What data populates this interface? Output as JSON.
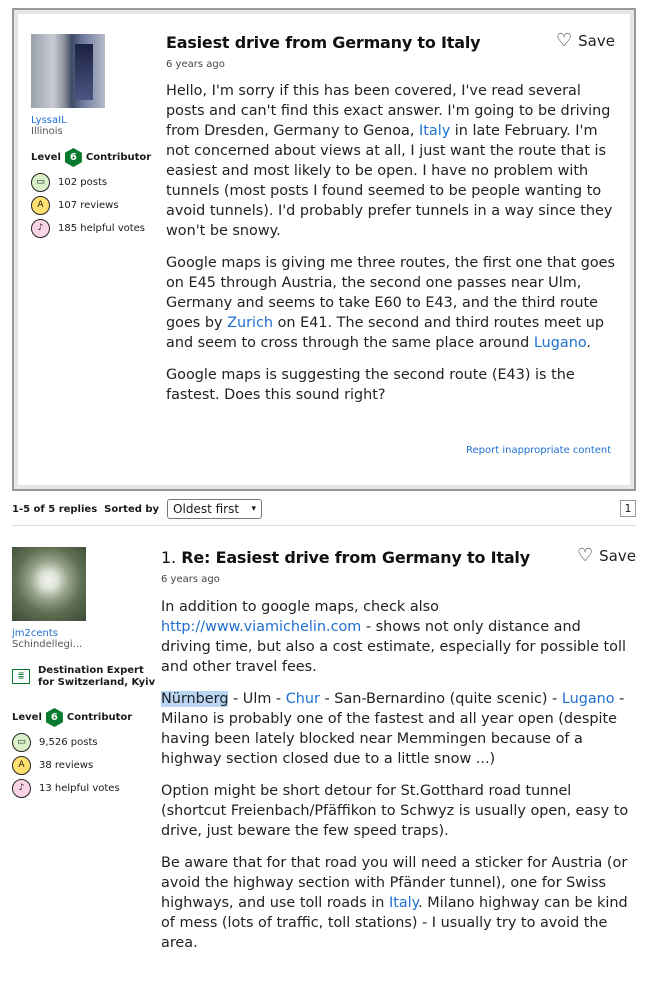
{
  "question": {
    "author": {
      "name": "LyssaIL",
      "location": "Illinois",
      "level_label": "Level",
      "level": "6",
      "level_suffix": "Contributor"
    },
    "stats": {
      "posts": "102 posts",
      "reviews": "107 reviews",
      "votes": "185 helpful votes"
    },
    "title": "Easiest drive from Germany to Italy",
    "time": "6 years ago",
    "save_label": "Save",
    "p1_a": "Hello, I'm sorry if this has been covered, I've read several posts and can't find this exact answer. I'm going to be driving from Dresden, Germany to Genoa, ",
    "p1_link": "Italy",
    "p1_b": " in late February. I'm not concerned about views at all, I just want the route that is easiest and most likely to be open. I have no problem with tunnels (most posts I found seemed to be people wanting to avoid tunnels). I'd probably prefer tunnels in a way since they won't be snowy.",
    "p2_a": "Google maps is giving me three routes, the first one that goes on E45 through Austria, the second one passes near Ulm, Germany and seems to take E60 to E43, and the third route goes by ",
    "p2_link1": "Zurich",
    "p2_b": " on E41. The second and third routes meet up and seem to cross through the same place around ",
    "p2_link2": "Lugano",
    "p2_c": ".",
    "p3": "Google maps is suggesting the second route (E43) is the fastest. Does this sound right?",
    "report": "Report inappropriate content"
  },
  "pager": {
    "count": "1-5 of 5 replies",
    "sorted_by": "Sorted by",
    "sort_value": "Oldest first",
    "page": "1"
  },
  "reply": {
    "author": {
      "name": "jm2cents",
      "location": "Schindellegi...",
      "level_label": "Level",
      "level": "6",
      "level_suffix": "Contributor"
    },
    "expert_line1": "Destination Expert",
    "expert_line2": "for Switzerland, Kyiv",
    "stats": {
      "posts": "9,526 posts",
      "reviews": "38 reviews",
      "votes": "13 helpful votes"
    },
    "number": "1.",
    "title": "Re: Easiest drive from Germany to Italy",
    "time": "6 years ago",
    "save_label": "Save",
    "p1_a": "In addition to google maps, check also",
    "p1_link": "http://www.viamichelin.com",
    "p1_b": " - shows not only distance and driving time, but also a cost estimate, especially for possible toll and other travel fees.",
    "p2_hl": "Nürnberg",
    "p2_a": " - Ulm - ",
    "p2_link1": "Chur",
    "p2_b": " - San-Bernardino (quite scenic) - ",
    "p2_link2": "Lugano",
    "p2_c": " - Milano is probably one of the fastest and all year open (despite having been lately blocked near Memmingen because of a highway section closed due to a little snow ...)",
    "p3": "Option might be short detour for St.Gotthard road tunnel (shortcut Freienbach/Pfäffikon to Schwyz is usually open, easy to drive, just beware the few speed traps).",
    "p4_a": "Be aware that for that road you will need a sticker for Austria (or avoid the highway section with Pfänder tunnel), one for Swiss highways, and use toll roads in ",
    "p4_link": "Italy",
    "p4_b": ". Milano highway can be kind of mess (lots of traffic, toll stations) - I usually try to avoid the area."
  }
}
